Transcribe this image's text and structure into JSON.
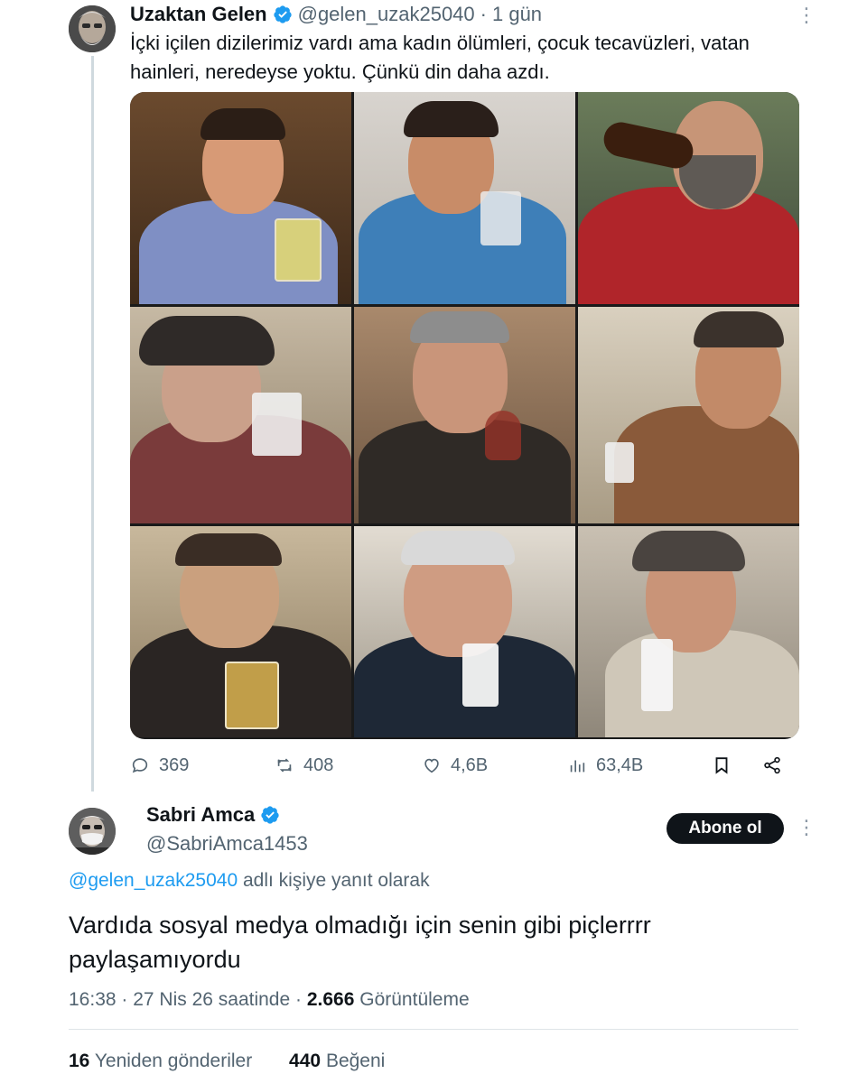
{
  "tweet1": {
    "author_name": "Uzaktan Gelen",
    "handle": "@gelen_uzak25040",
    "separator": "·",
    "time": "1 gün",
    "text": "İçki içilen dizilerimiz vardı ama kadın ölümleri, çocuk tecavüzleri, vatan hainleri, neredeyse yoktu. Çünkü din daha azdı.",
    "media_description": "9-panel grid of actors drinking in classic TV series",
    "actions": {
      "replies": "369",
      "retweets": "408",
      "likes": "4,6B",
      "views": "63,4B"
    },
    "icons": [
      "comment-icon",
      "retweet-icon",
      "heart-icon",
      "views-icon",
      "bookmark-icon",
      "share-icon",
      "more-icon",
      "verified-icon"
    ]
  },
  "tweet2": {
    "author_name": "Sabri Amca",
    "handle": "@SabriAmca1453",
    "follow_label": "Abone ol",
    "reply_to_handle": "@gelen_uzak25040",
    "reply_to_suffix": "adlı kişiye yanıt olarak",
    "text": "Vardıda sosyal medya olmadığı için senin gibi piçlerrrr paylaşamıyordu",
    "timestamp": "16:38 · 27 Nis 26 saatinde ·",
    "views_count": "2.666",
    "views_label": "Görüntüleme",
    "reposts_count": "16",
    "reposts_label": "Yeniden gönderiler",
    "likes_count": "440",
    "likes_label": "Beğeni"
  },
  "colors": {
    "accent": "#1d9bf0",
    "text": "#0f1419",
    "muted": "#536471",
    "follow_button": "#0f1419"
  }
}
